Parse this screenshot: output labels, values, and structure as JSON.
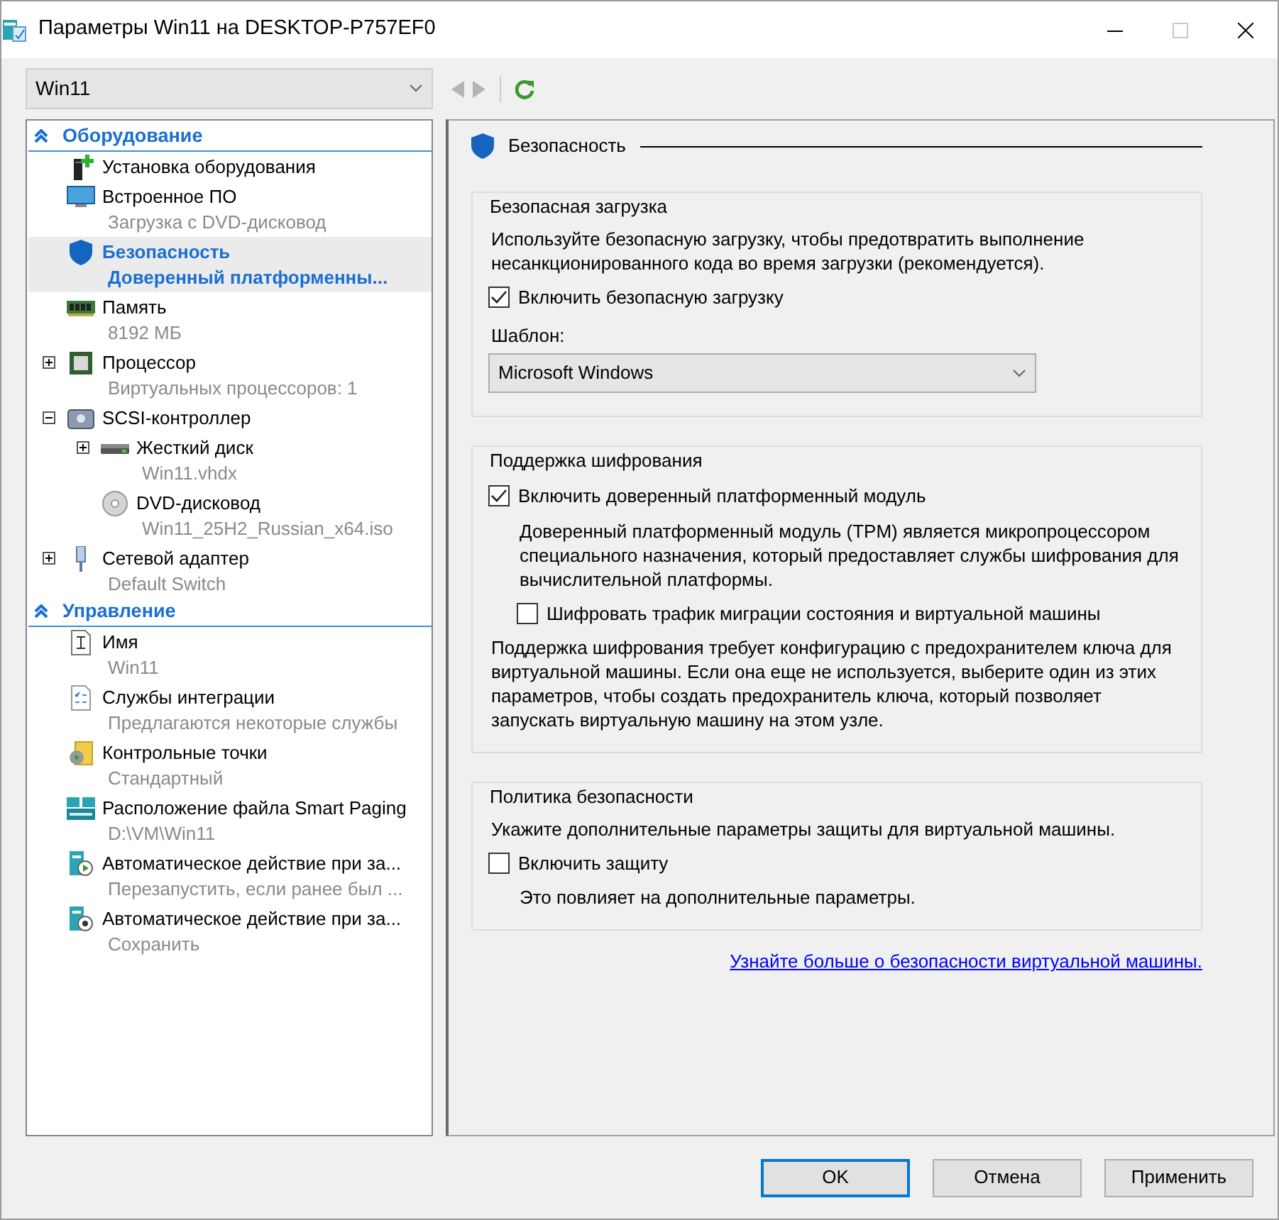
{
  "window": {
    "title": "Параметры Win11 на DESKTOP-P757EF0"
  },
  "vm_select": {
    "value": "Win11"
  },
  "toolbar": [
    {
      "kind": "back",
      "disabled": true
    },
    {
      "kind": "forward",
      "disabled": true
    },
    {
      "kind": "refresh",
      "disabled": false
    }
  ],
  "tree": [
    {
      "label": "Оборудование",
      "expanded": true,
      "items": [
        {
          "kind": "add-hardware",
          "label": "Установка оборудования",
          "selected": false
        },
        {
          "kind": "firmware",
          "label": "Встроенное ПО",
          "detail": "Загрузка с DVD-дисковод",
          "selected": false
        },
        {
          "kind": "security",
          "label": "Безопасность",
          "detail": "Доверенный платформенны...",
          "selected": true
        },
        {
          "kind": "memory",
          "label": "Память",
          "detail": "8192 МБ",
          "selected": false
        },
        {
          "kind": "processor",
          "label": "Процессор",
          "detail": "Виртуальных процессоров: 1",
          "expanded": false,
          "selected": false
        },
        {
          "kind": "controller",
          "label": "SCSI-контроллер",
          "expanded": true,
          "selected": false,
          "children": [
            {
              "kind": "disk",
              "label": "Жесткий диск",
              "detail": "Win11.vhdx",
              "expanded": false,
              "selected": false
            },
            {
              "kind": "dvd",
              "label": "DVD-дисковод",
              "detail": "Win11_25H2_Russian_x64.iso",
              "selected": false
            }
          ]
        },
        {
          "kind": "network",
          "label": "Сетевой адаптер",
          "detail": "Default Switch",
          "expanded": false,
          "selected": false
        }
      ]
    },
    {
      "label": "Управление",
      "expanded": true,
      "items": [
        {
          "kind": "name",
          "label": "Имя",
          "detail": "Win11",
          "selected": false
        },
        {
          "kind": "services",
          "label": "Службы интеграции",
          "detail": "Предлагаются некоторые службы",
          "selected": false
        },
        {
          "kind": "checkpoints",
          "label": "Контрольные точки",
          "detail": "Стандартный",
          "selected": false
        },
        {
          "kind": "paging",
          "label": "Расположение файла Smart Paging",
          "detail": "D:\\VM\\Win11",
          "selected": false
        },
        {
          "kind": "autostart",
          "label": "Автоматическое действие при за...",
          "detail": "Перезапустить, если ранее был ...",
          "selected": false
        },
        {
          "kind": "autostop",
          "label": "Автоматическое действие при за...",
          "detail": "Сохранить",
          "selected": false
        }
      ]
    }
  ],
  "panel": {
    "title": "Безопасность",
    "groups": [
      {
        "title": "Безопасная загрузка",
        "content": [
          {
            "kind": "text",
            "text": "Используйте безопасную загрузку, чтобы предотвратить выполнение несанкционированного кода во время загрузки (рекомендуется)."
          },
          {
            "kind": "checkbox",
            "label": "Включить безопасную загрузку",
            "checked": true
          },
          {
            "kind": "field-label",
            "text": "Шаблон:"
          },
          {
            "kind": "select",
            "value": "Microsoft Windows"
          }
        ]
      },
      {
        "title": "Поддержка шифрования",
        "content": [
          {
            "kind": "checkbox",
            "label": "Включить доверенный платформенный модуль",
            "checked": true,
            "children": [
              {
                "kind": "text",
                "text": "Доверенный платформенный модуль (TPM) является микропроцессором специального назначения, который предоставляет службы шифрования для вычислительной платформы."
              },
              {
                "kind": "checkbox",
                "label": "Шифровать трафик миграции состояния и виртуальной машины",
                "checked": false
              }
            ]
          },
          {
            "kind": "text",
            "text": "Поддержка шифрования требует конфигурацию с предохранителем ключа для виртуальной машины. Если она еще не используется, выберите один из этих параметров, чтобы создать предохранитель ключа, который позволяет запускать виртуальную машину на этом узле."
          }
        ]
      },
      {
        "title": "Политика безопасности",
        "content": [
          {
            "kind": "text",
            "text": "Укажите дополнительные параметры защиты для виртуальной машины."
          },
          {
            "kind": "checkbox",
            "label": "Включить защиту",
            "checked": false,
            "children": [
              {
                "kind": "text",
                "text": "Это повлияет на дополнительные параметры."
              }
            ]
          }
        ]
      }
    ],
    "link": "Узнайте больше о безопасности виртуальной машины."
  },
  "buttons": [
    {
      "label": "OK",
      "default": true
    },
    {
      "label": "Отмена",
      "default": false
    },
    {
      "label": "Применить",
      "default": false
    }
  ]
}
